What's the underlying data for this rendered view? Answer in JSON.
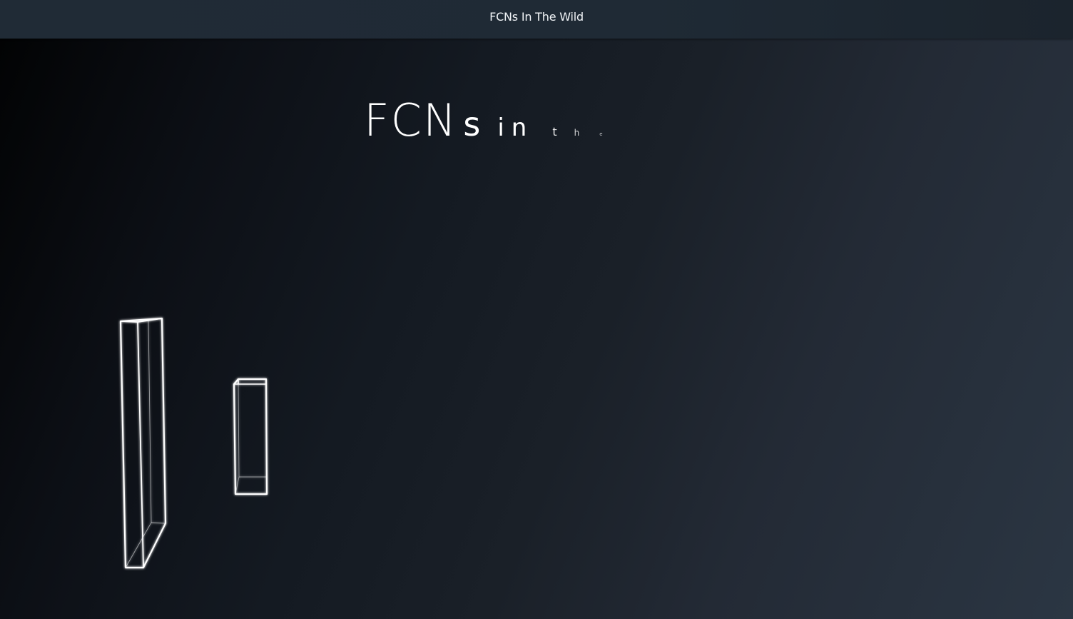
{
  "header": {
    "title": "FCNs In The Wild"
  },
  "hero": {
    "headline_parts": [
      "FCN",
      "s",
      "i",
      "n",
      "t",
      "h",
      "e"
    ]
  },
  "colors": {
    "header_bg": "#1f2a35",
    "text": "#ffffff",
    "wireframe": "#ffffff"
  }
}
